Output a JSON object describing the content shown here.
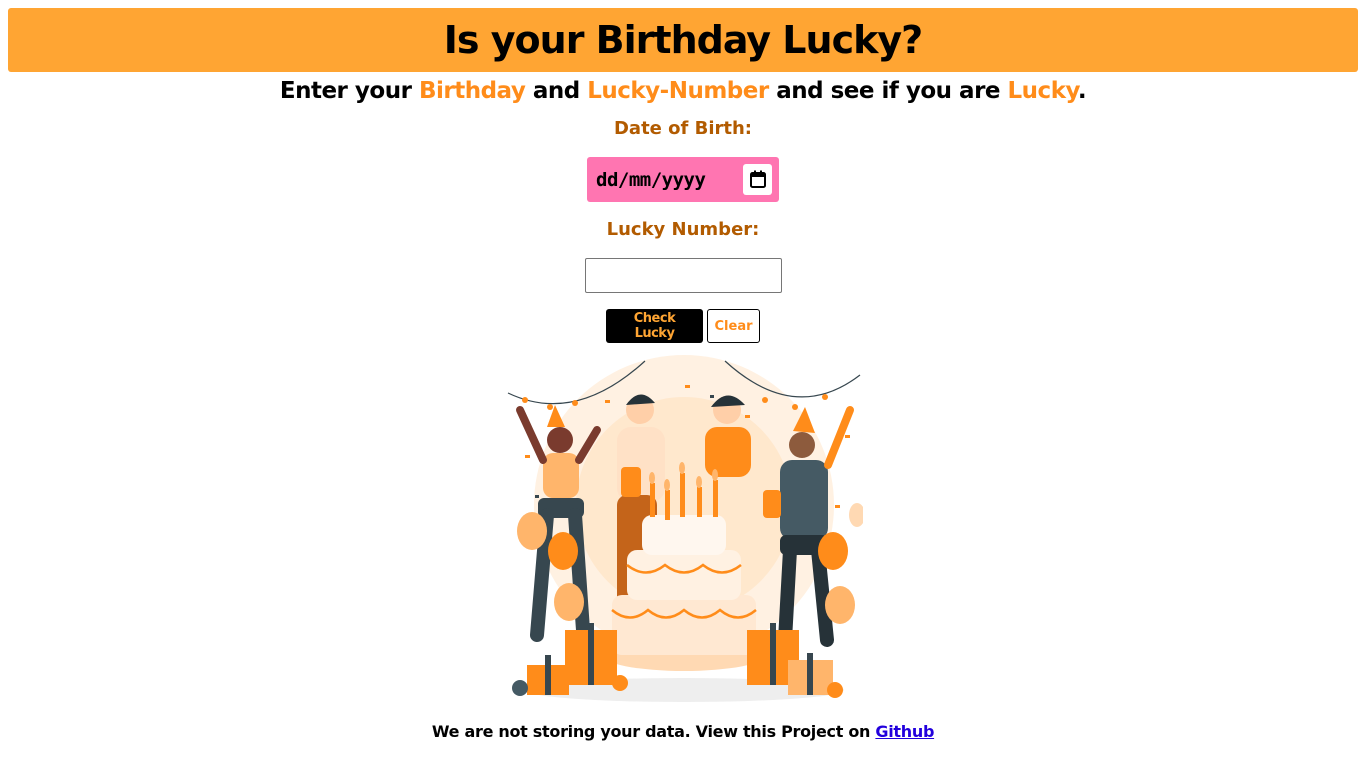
{
  "header": {
    "title": "Is your Birthday Lucky?"
  },
  "subtitle": {
    "p1": "Enter your ",
    "h1": "Birthday",
    "p2": " and ",
    "h2": "Lucky-Number",
    "p3": " and see if you are ",
    "h3": "Lucky",
    "p4": "."
  },
  "form": {
    "dob_label": "Date of Birth:",
    "dob_placeholder": "dd/mm/yyyy",
    "lucky_label": "Lucky Number:",
    "lucky_value": "",
    "check_label": "Check Lucky",
    "clear_label": "Clear"
  },
  "illustration": {
    "icon": "birthday-party-illustration"
  },
  "footer": {
    "text": "We are not storing your data. View this Project on ",
    "link_label": "Github"
  },
  "colors": {
    "accent": "#ffa533",
    "highlight": "#ff8c1a",
    "label": "#b25b00",
    "date_bg": "#ff75b1"
  }
}
